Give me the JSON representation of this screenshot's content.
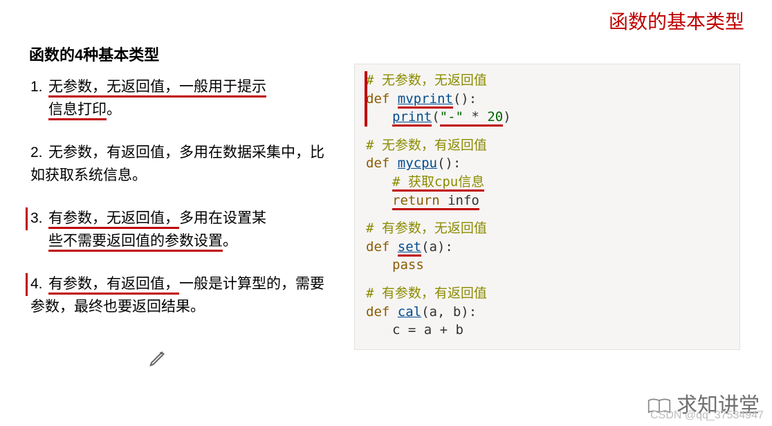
{
  "top_title": "函数的基本类型",
  "heading": "函数的4种基本类型",
  "items": [
    {
      "num": "1.",
      "seg1": "无参数，",
      "seg2": "无返回值，",
      "seg3": "一般用于提示",
      "seg4": "信息打印",
      "seg5": "。"
    },
    {
      "num": "2.",
      "text": "无参数，有返回值，多用在数据采集中，比如获取系统信息。"
    },
    {
      "num": "3.",
      "seg1": "有参数，",
      "seg2": "无返回值，",
      "seg3": "多用在设置某",
      "seg4": "些不需要返回值的参数设置",
      "seg5": "。"
    },
    {
      "num": "4.",
      "seg1": "有参数，",
      "seg2": "有返回值，",
      "seg3": "一般是计算型的，需要参数，最终也要返回结果。"
    }
  ],
  "code": {
    "c1": "# 无参数，无返回值",
    "fn1": "mvprint",
    "print1": "print",
    "str1": "\"-\"",
    "mul": " * ",
    "n20": "20",
    "c2": "# 无参数，有返回值",
    "fn2": "mycpu",
    "c2b": "# 获取cpu信息",
    "ret": "return",
    "info": " info",
    "c3": "# 有参数，无返回值",
    "fn3": "set",
    "args3": "(a):",
    "pass": "pass",
    "c4": "# 有参数，有返回值",
    "fn4": "cal",
    "args4": "(a, b):",
    "body4": "c = a + b",
    "def": "def ",
    "colon": "():"
  },
  "brand": "求知讲堂",
  "watermark": "CSDN @qq_37534947"
}
